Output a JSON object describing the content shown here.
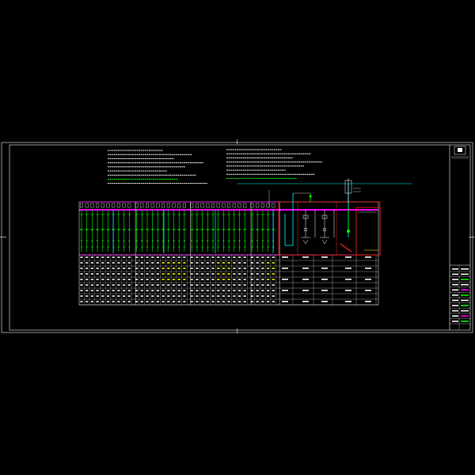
{
  "drawing": {
    "background": "#000000",
    "colors": {
      "frame": "#ffffff",
      "bus_magenta": "#ff00ff",
      "feeder_green": "#00ff00",
      "feeder_yellow": "#ffff00",
      "cyan": "#00ffff",
      "red_box": "#ff2020",
      "blue": "#3060ff",
      "text_white": "#ffffff"
    },
    "title_block": {
      "logo_icon": "company-logo-icon"
    }
  },
  "notes": {
    "left_column_lines": [
      "",
      "",
      "",
      "",
      "",
      "",
      "",
      "",
      ""
    ],
    "right_column_lines": [
      "",
      "",
      "",
      "",
      "",
      "",
      "",
      ""
    ]
  },
  "panel_groups": [
    {
      "feeders": 10
    },
    {
      "feeders": 10
    },
    {
      "feeders": 11
    },
    {
      "feeders": 5
    }
  ]
}
